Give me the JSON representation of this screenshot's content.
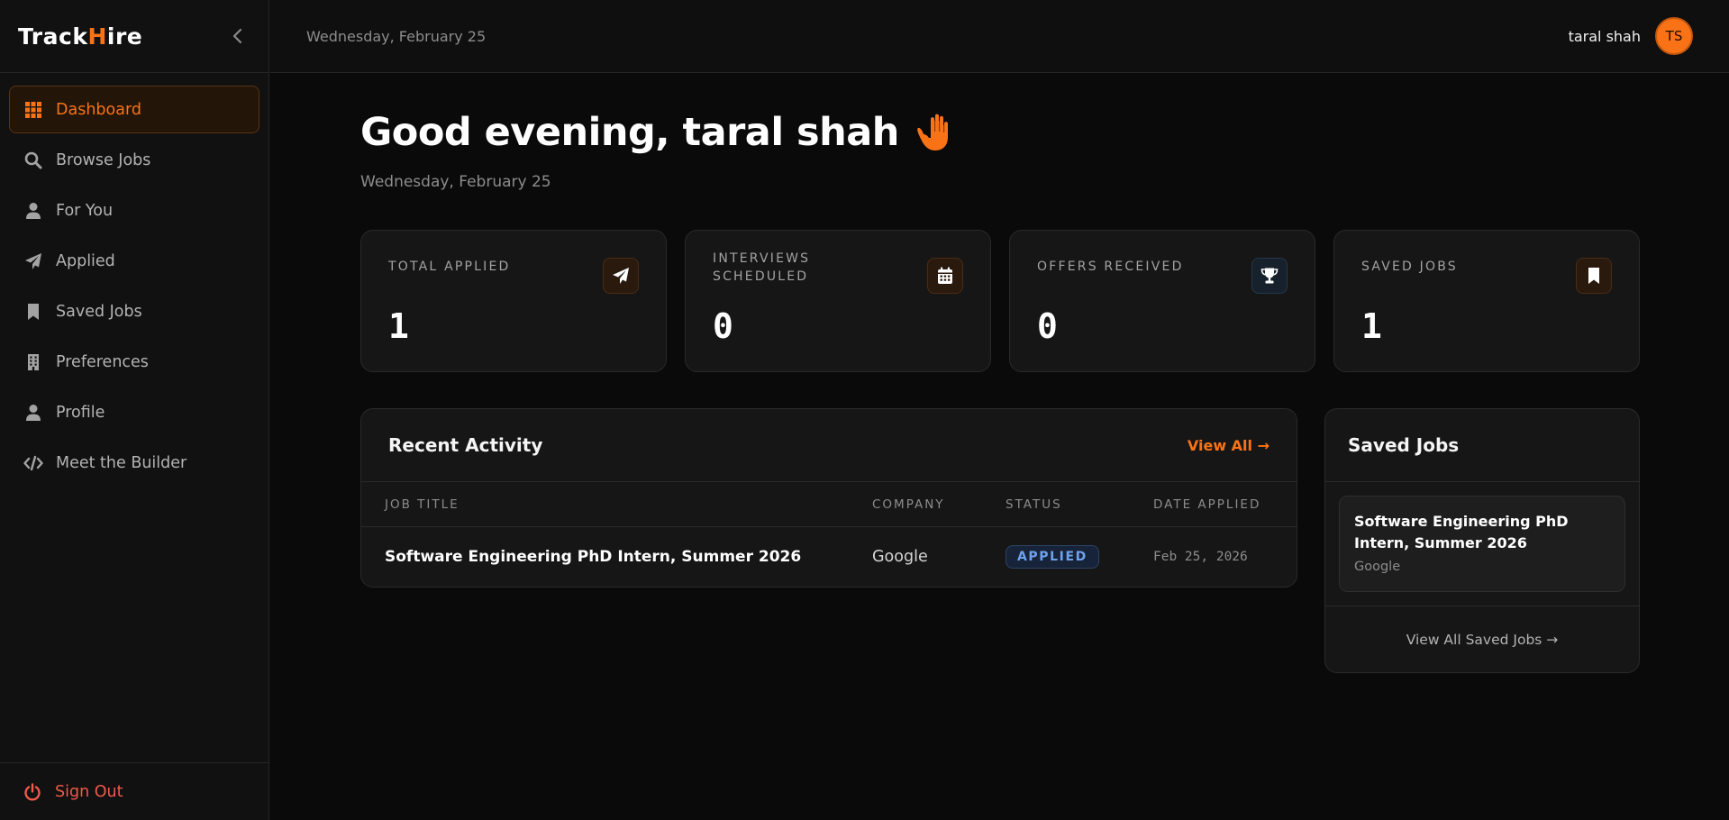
{
  "sidebar": {
    "logo": {
      "prefix": "Track",
      "accent": "H",
      "suffix": "ire"
    },
    "items": [
      {
        "label": "Dashboard",
        "icon": "grid-icon"
      },
      {
        "label": "Browse Jobs",
        "icon": "search-icon"
      },
      {
        "label": "For You",
        "icon": "user-icon"
      },
      {
        "label": "Applied",
        "icon": "paper-plane-icon"
      },
      {
        "label": "Saved Jobs",
        "icon": "bookmark-icon"
      },
      {
        "label": "Preferences",
        "icon": "building-icon"
      },
      {
        "label": "Profile",
        "icon": "user-icon"
      },
      {
        "label": "Meet the Builder",
        "icon": "code-icon"
      }
    ],
    "sign_out": "Sign Out"
  },
  "topbar": {
    "date": "Wednesday, February 25",
    "user_name": "taral shah",
    "avatar_initials": "TS"
  },
  "main": {
    "greeting": "Good evening, taral shah",
    "date": "Wednesday, February 25"
  },
  "stats": [
    {
      "label": "Total Applied",
      "value": "1",
      "icon": "paper-plane-icon"
    },
    {
      "label": "Interviews Scheduled",
      "value": "0",
      "icon": "calendar-icon"
    },
    {
      "label": "Offers Received",
      "value": "0",
      "icon": "trophy-icon"
    },
    {
      "label": "Saved Jobs",
      "value": "1",
      "icon": "bookmark-icon"
    }
  ],
  "recent_activity": {
    "title": "Recent Activity",
    "view_all": "View All →",
    "columns": [
      "JOB TITLE",
      "COMPANY",
      "STATUS",
      "DATE APPLIED"
    ],
    "rows": [
      {
        "job_title": "Software Engineering PhD Intern, Summer 2026",
        "company": "Google",
        "status": "APPLIED",
        "date": "Feb 25, 2026"
      }
    ]
  },
  "saved_jobs": {
    "title": "Saved Jobs",
    "items": [
      {
        "title": "Software Engineering PhD Intern, Summer 2026",
        "company": "Google"
      }
    ],
    "view_all": "View All Saved Jobs →"
  },
  "colors": {
    "accent": "#f97316",
    "background": "#0a0a0a",
    "status_blue": "#6fa2ee",
    "danger": "#ef5a4a"
  }
}
